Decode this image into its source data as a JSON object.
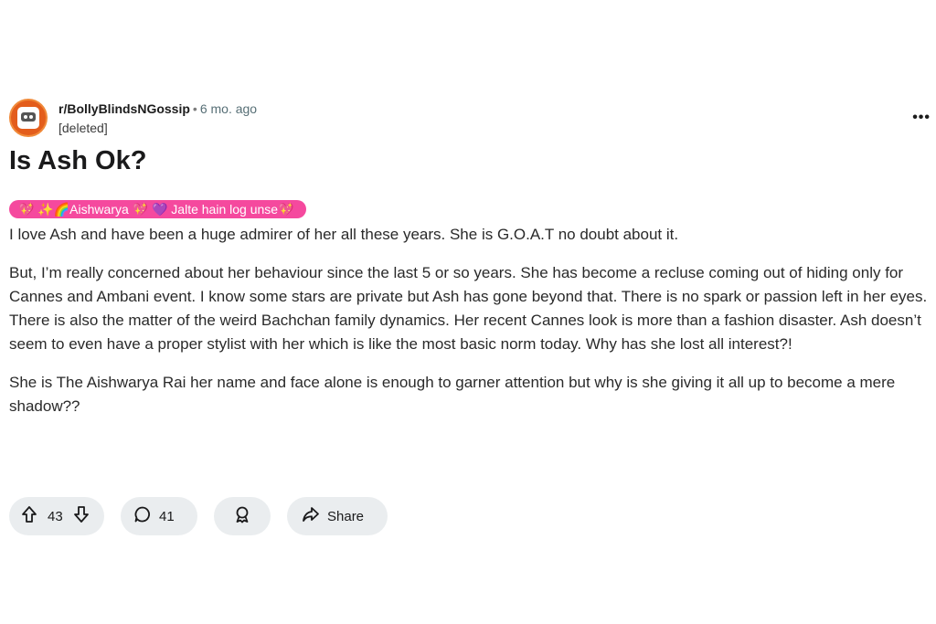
{
  "post": {
    "subreddit": "r/BollyBlindsNGossip",
    "separator": "•",
    "time": "6 mo. ago",
    "author": "[deleted]",
    "title": "Is Ash Ok?",
    "flair": "💖 ✨🌈Aishwarya 💖 💜 Jalte hain log unse💖",
    "paragraphs": [
      "I love Ash and have been a huge admirer of her all these years. She is G.O.A.T no doubt about it.",
      "But, I’m really concerned about her behaviour since the last 5 or so years. She has become a recluse coming out of hiding only for Cannes and Ambani event. I know some stars are private but Ash has gone beyond that. There is no spark or passion left in her eyes. There is also the matter of the weird Bachchan family dynamics. Her recent Cannes look is more than a fashion disaster. Ash doesn’t seem to even have a proper stylist with her which is like the most basic norm today. Why has she lost all interest?!",
      "She is The Aishwarya Rai her name and face alone is enough to garner attention but why is she giving it all up to become a mere shadow??"
    ]
  },
  "actions": {
    "upvotes": "43",
    "comments": "41",
    "share_label": "Share"
  },
  "icons": {
    "upvote": "upvote-arrow-icon",
    "downvote": "downvote-arrow-icon",
    "comment": "comment-bubble-icon",
    "award": "award-icon",
    "share": "share-arrow-icon",
    "more": "more-options-icon"
  },
  "colors": {
    "flair_bg": "#f5499e",
    "avatar_bg": "#e35d1c",
    "pill_bg": "#eaedef"
  }
}
